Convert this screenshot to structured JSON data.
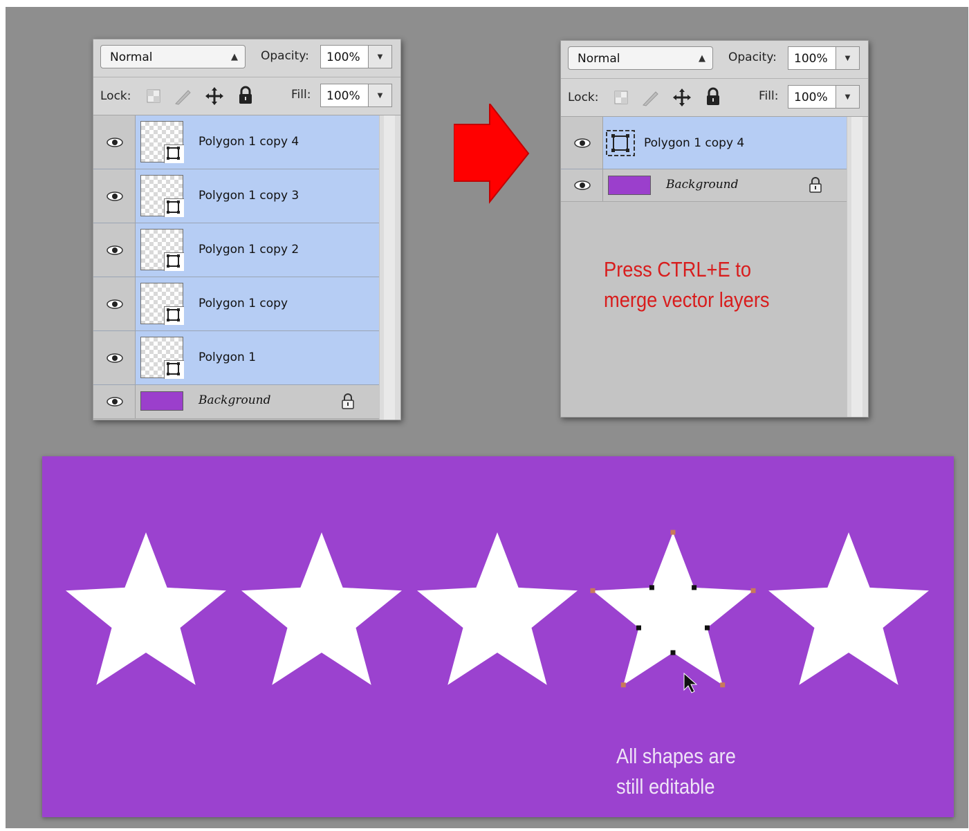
{
  "left_panel": {
    "blend_mode": "Normal",
    "opacity_label": "Opacity:",
    "opacity_value": "100%",
    "lock_label": "Lock:",
    "fill_label": "Fill:",
    "fill_value": "100%",
    "layers": [
      {
        "name": "Polygon 1 copy 4",
        "selected": true
      },
      {
        "name": "Polygon 1 copy 3",
        "selected": true
      },
      {
        "name": "Polygon 1 copy 2",
        "selected": true
      },
      {
        "name": "Polygon 1 copy",
        "selected": true
      },
      {
        "name": "Polygon 1",
        "selected": true
      },
      {
        "name": "Background",
        "selected": false,
        "locked": true
      }
    ]
  },
  "right_panel": {
    "blend_mode": "Normal",
    "opacity_label": "Opacity:",
    "opacity_value": "100%",
    "lock_label": "Lock:",
    "fill_label": "Fill:",
    "fill_value": "100%",
    "layers": [
      {
        "name": "Polygon 1 copy 4",
        "selected": true
      },
      {
        "name": "Background",
        "selected": false,
        "locked": true
      }
    ],
    "note_line1": "Press CTRL+E to",
    "note_line2": "merge vector layers"
  },
  "canvas": {
    "background_color": "#9b42cf",
    "star_count": 5,
    "selected_star_index": 3,
    "caption_line1": "All shapes are",
    "caption_line2": "still editable"
  },
  "colors": {
    "selection": "#b6cdf4",
    "arrow": "#ff0000",
    "note_text": "#d81d1d",
    "swatch": "#9b3fcc"
  }
}
